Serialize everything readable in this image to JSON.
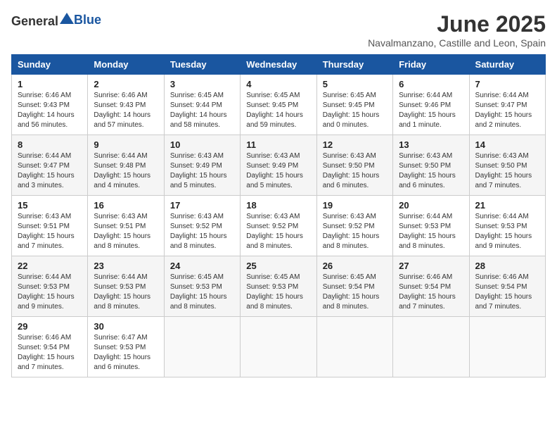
{
  "logo": {
    "text_general": "General",
    "text_blue": "Blue"
  },
  "title": "June 2025",
  "location": "Navalmanzano, Castille and Leon, Spain",
  "days_of_week": [
    "Sunday",
    "Monday",
    "Tuesday",
    "Wednesday",
    "Thursday",
    "Friday",
    "Saturday"
  ],
  "weeks": [
    [
      {
        "day": "1",
        "sunrise": "6:46 AM",
        "sunset": "9:43 PM",
        "daylight": "14 hours and 56 minutes."
      },
      {
        "day": "2",
        "sunrise": "6:46 AM",
        "sunset": "9:43 PM",
        "daylight": "14 hours and 57 minutes."
      },
      {
        "day": "3",
        "sunrise": "6:45 AM",
        "sunset": "9:44 PM",
        "daylight": "14 hours and 58 minutes."
      },
      {
        "day": "4",
        "sunrise": "6:45 AM",
        "sunset": "9:45 PM",
        "daylight": "14 hours and 59 minutes."
      },
      {
        "day": "5",
        "sunrise": "6:45 AM",
        "sunset": "9:45 PM",
        "daylight": "15 hours and 0 minutes."
      },
      {
        "day": "6",
        "sunrise": "6:44 AM",
        "sunset": "9:46 PM",
        "daylight": "15 hours and 1 minute."
      },
      {
        "day": "7",
        "sunrise": "6:44 AM",
        "sunset": "9:47 PM",
        "daylight": "15 hours and 2 minutes."
      }
    ],
    [
      {
        "day": "8",
        "sunrise": "6:44 AM",
        "sunset": "9:47 PM",
        "daylight": "15 hours and 3 minutes."
      },
      {
        "day": "9",
        "sunrise": "6:44 AM",
        "sunset": "9:48 PM",
        "daylight": "15 hours and 4 minutes."
      },
      {
        "day": "10",
        "sunrise": "6:43 AM",
        "sunset": "9:49 PM",
        "daylight": "15 hours and 5 minutes."
      },
      {
        "day": "11",
        "sunrise": "6:43 AM",
        "sunset": "9:49 PM",
        "daylight": "15 hours and 5 minutes."
      },
      {
        "day": "12",
        "sunrise": "6:43 AM",
        "sunset": "9:50 PM",
        "daylight": "15 hours and 6 minutes."
      },
      {
        "day": "13",
        "sunrise": "6:43 AM",
        "sunset": "9:50 PM",
        "daylight": "15 hours and 6 minutes."
      },
      {
        "day": "14",
        "sunrise": "6:43 AM",
        "sunset": "9:50 PM",
        "daylight": "15 hours and 7 minutes."
      }
    ],
    [
      {
        "day": "15",
        "sunrise": "6:43 AM",
        "sunset": "9:51 PM",
        "daylight": "15 hours and 7 minutes."
      },
      {
        "day": "16",
        "sunrise": "6:43 AM",
        "sunset": "9:51 PM",
        "daylight": "15 hours and 8 minutes."
      },
      {
        "day": "17",
        "sunrise": "6:43 AM",
        "sunset": "9:52 PM",
        "daylight": "15 hours and 8 minutes."
      },
      {
        "day": "18",
        "sunrise": "6:43 AM",
        "sunset": "9:52 PM",
        "daylight": "15 hours and 8 minutes."
      },
      {
        "day": "19",
        "sunrise": "6:43 AM",
        "sunset": "9:52 PM",
        "daylight": "15 hours and 8 minutes."
      },
      {
        "day": "20",
        "sunrise": "6:44 AM",
        "sunset": "9:53 PM",
        "daylight": "15 hours and 8 minutes."
      },
      {
        "day": "21",
        "sunrise": "6:44 AM",
        "sunset": "9:53 PM",
        "daylight": "15 hours and 9 minutes."
      }
    ],
    [
      {
        "day": "22",
        "sunrise": "6:44 AM",
        "sunset": "9:53 PM",
        "daylight": "15 hours and 9 minutes."
      },
      {
        "day": "23",
        "sunrise": "6:44 AM",
        "sunset": "9:53 PM",
        "daylight": "15 hours and 8 minutes."
      },
      {
        "day": "24",
        "sunrise": "6:45 AM",
        "sunset": "9:53 PM",
        "daylight": "15 hours and 8 minutes."
      },
      {
        "day": "25",
        "sunrise": "6:45 AM",
        "sunset": "9:53 PM",
        "daylight": "15 hours and 8 minutes."
      },
      {
        "day": "26",
        "sunrise": "6:45 AM",
        "sunset": "9:54 PM",
        "daylight": "15 hours and 8 minutes."
      },
      {
        "day": "27",
        "sunrise": "6:46 AM",
        "sunset": "9:54 PM",
        "daylight": "15 hours and 7 minutes."
      },
      {
        "day": "28",
        "sunrise": "6:46 AM",
        "sunset": "9:54 PM",
        "daylight": "15 hours and 7 minutes."
      }
    ],
    [
      {
        "day": "29",
        "sunrise": "6:46 AM",
        "sunset": "9:54 PM",
        "daylight": "15 hours and 7 minutes."
      },
      {
        "day": "30",
        "sunrise": "6:47 AM",
        "sunset": "9:53 PM",
        "daylight": "15 hours and 6 minutes."
      },
      null,
      null,
      null,
      null,
      null
    ]
  ]
}
